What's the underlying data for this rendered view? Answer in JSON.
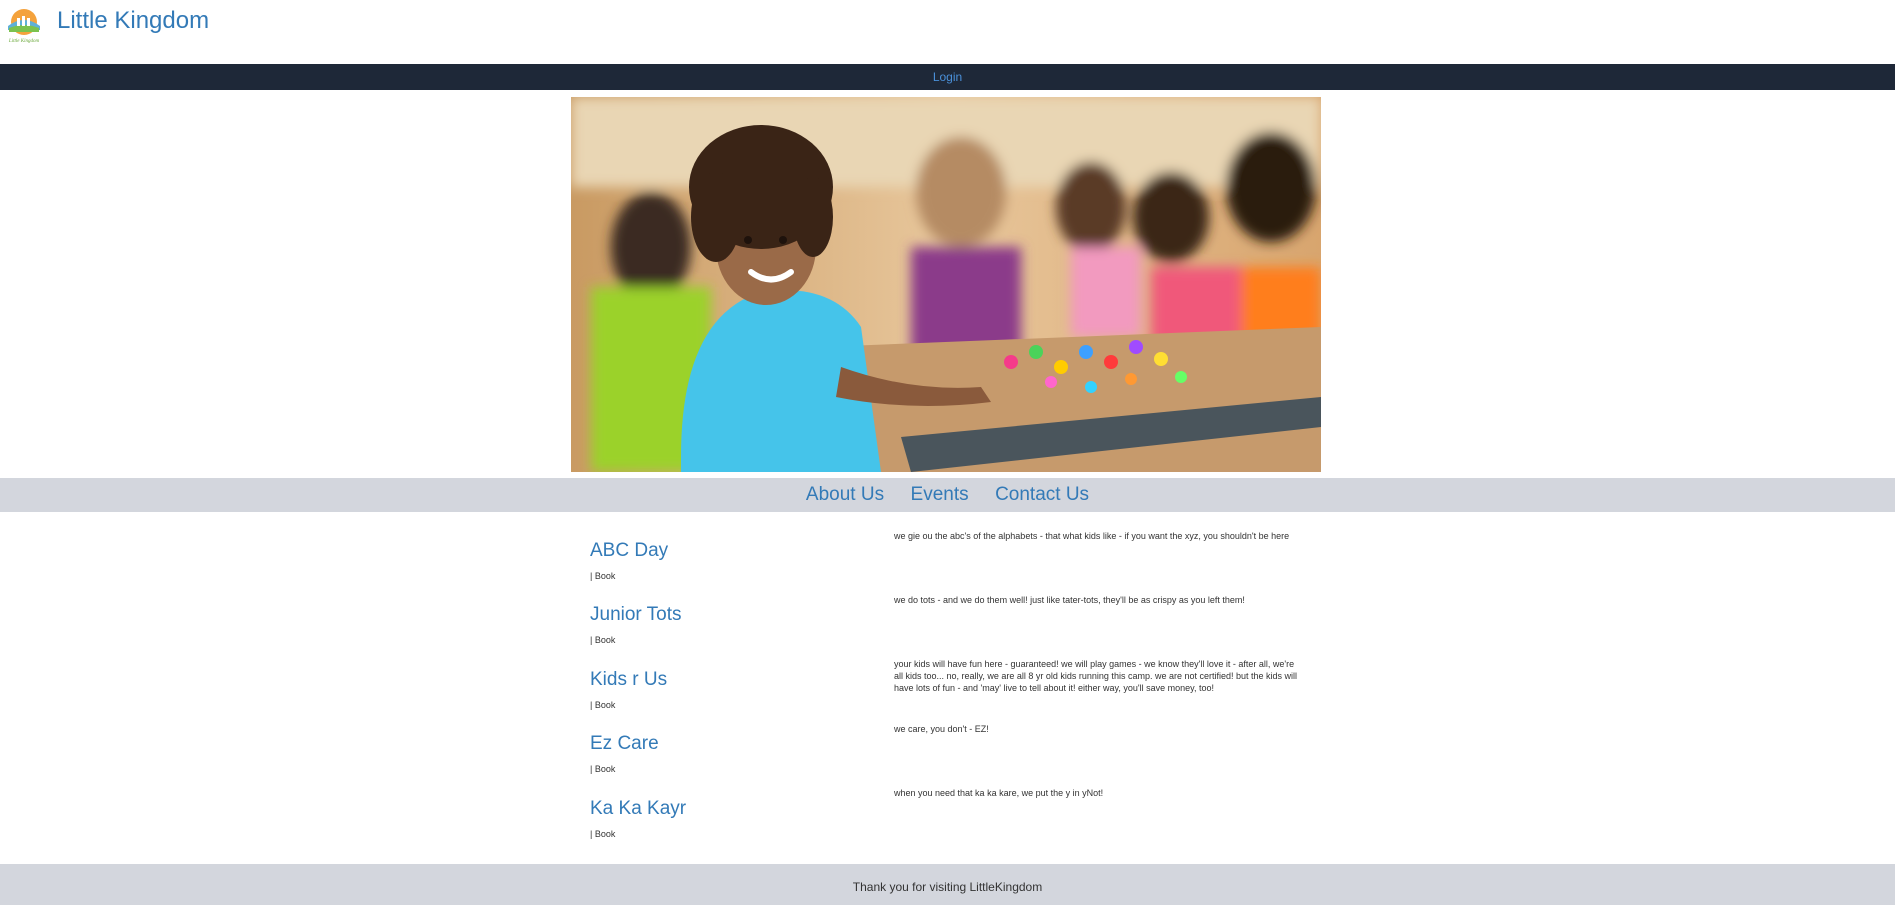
{
  "header": {
    "title": "Little Kingdom",
    "logo_text": "Little Kingdom"
  },
  "topnav": {
    "login": "Login"
  },
  "hero": {
    "image": "hero-photo"
  },
  "mainnav": {
    "items": [
      "About Us",
      "Events",
      "Contact Us"
    ]
  },
  "events": [
    {
      "name": "ABC Day",
      "book": "| Book",
      "description": "we gie ou the abc's of the alphabets - that what kids like - if you want the xyz, you shouldn't be here"
    },
    {
      "name": "Junior Tots",
      "book": "| Book",
      "description": "we do tots - and we do them well! just like tater-tots, they'll be as crispy as you left them!"
    },
    {
      "name": "Kids r Us",
      "book": "| Book",
      "description": "your kids will have fun here - guaranteed! we will play games - we know they'll love it - after all, we're all kids too... no, really, we are all 8 yr old kids running this camp. we are not certified! but the kids will have lots of fun - and 'may' live to tell about it! either way, you'll save money, too!"
    },
    {
      "name": "Ez Care",
      "book": "| Book",
      "description": "we care, you don't - EZ!"
    },
    {
      "name": "Ka Ka Kayr",
      "book": "| Book",
      "description": "when you need that ka ka kare, we put the y in yNot!"
    }
  ],
  "footer": {
    "text": "Thank you for visiting LittleKingdom"
  }
}
